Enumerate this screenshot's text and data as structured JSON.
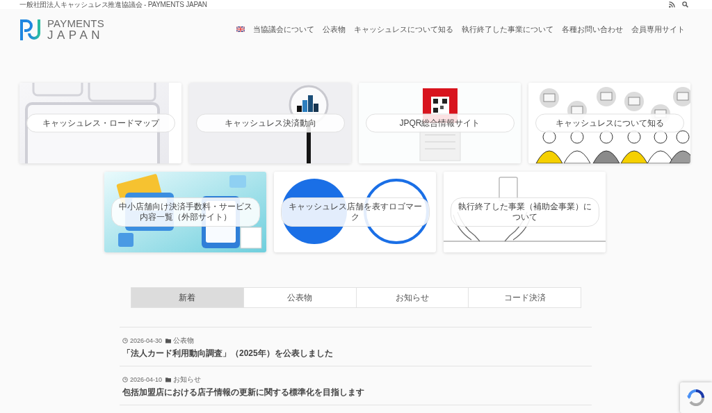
{
  "top_bar": {
    "site_name": "一般社団法人キャッシュレス推進協議会 - PAYMENTS JAPAN"
  },
  "header": {
    "logo": {
      "line1": "PAYMENTS",
      "line2": "JAPAN"
    },
    "nav": [
      {
        "label": "当協議会について"
      },
      {
        "label": "公表物"
      },
      {
        "label": "キャッシュレスについて知る"
      },
      {
        "label": "執行終了した事業について"
      },
      {
        "label": "各種お問い合わせ"
      },
      {
        "label": "会員専用サイト"
      }
    ]
  },
  "cards": [
    {
      "kind": "keyboard",
      "label": "キャッシュレス・ロードマップ"
    },
    {
      "kind": "magnifier",
      "label": "キャッシュレス決済動向"
    },
    {
      "kind": "qr-sign",
      "label": "JPQR総合情報サイト"
    },
    {
      "kind": "people",
      "label": "キャッシュレスについて知る"
    },
    {
      "kind": "terminal",
      "label": "中小店舗向け決済手数料・サービス内容一覧（外部サイト）"
    },
    {
      "kind": "logos",
      "label": "キャッシュレス店舗を表すロゴマーク"
    },
    {
      "kind": "hands",
      "label": "執行終了した事業（補助金事業）について"
    }
  ],
  "tabs": [
    {
      "label": "新着",
      "selected": true
    },
    {
      "label": "公表物",
      "selected": false
    },
    {
      "label": "お知らせ",
      "selected": false
    },
    {
      "label": "コード決済",
      "selected": false
    }
  ],
  "posts": [
    {
      "date": "2026-04-30",
      "category": "公表物",
      "title": "「法人カード利用動向調査」（2025年）を公表しました"
    },
    {
      "date": "2026-04-10",
      "category": "お知らせ",
      "title": "包括加盟店における店子情報の更新に関する標準化を目指します"
    }
  ]
}
